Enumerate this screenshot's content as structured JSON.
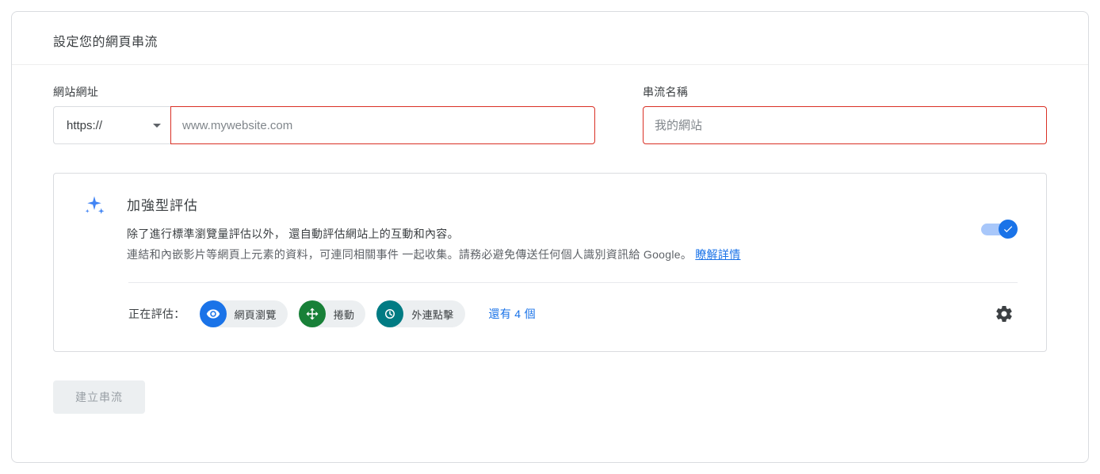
{
  "header": {
    "title": "設定您的網頁串流"
  },
  "fields": {
    "url": {
      "label": "網站網址",
      "protocol": "https://",
      "placeholder": "www.mywebsite.com"
    },
    "name": {
      "label": "串流名稱",
      "placeholder": "我的網站"
    }
  },
  "enhanced": {
    "title": "加強型評估",
    "desc_line1": "除了進行標準瀏覽量評估以外， 還自動評估網站上的互動和內容。",
    "desc_line2": "連結和內嵌影片等網頁上元素的資料，可連同相關事件 一起收集。請務必避免傳送任何個人識別資訊給 Google。",
    "learn_more": "瞭解詳情",
    "measuring_label": "正在評估：",
    "chips": {
      "pageview": "網頁瀏覽",
      "scroll": "捲動",
      "outbound": "外連點擊"
    },
    "more_link": "還有 4 個"
  },
  "submit": {
    "label": "建立串流"
  }
}
